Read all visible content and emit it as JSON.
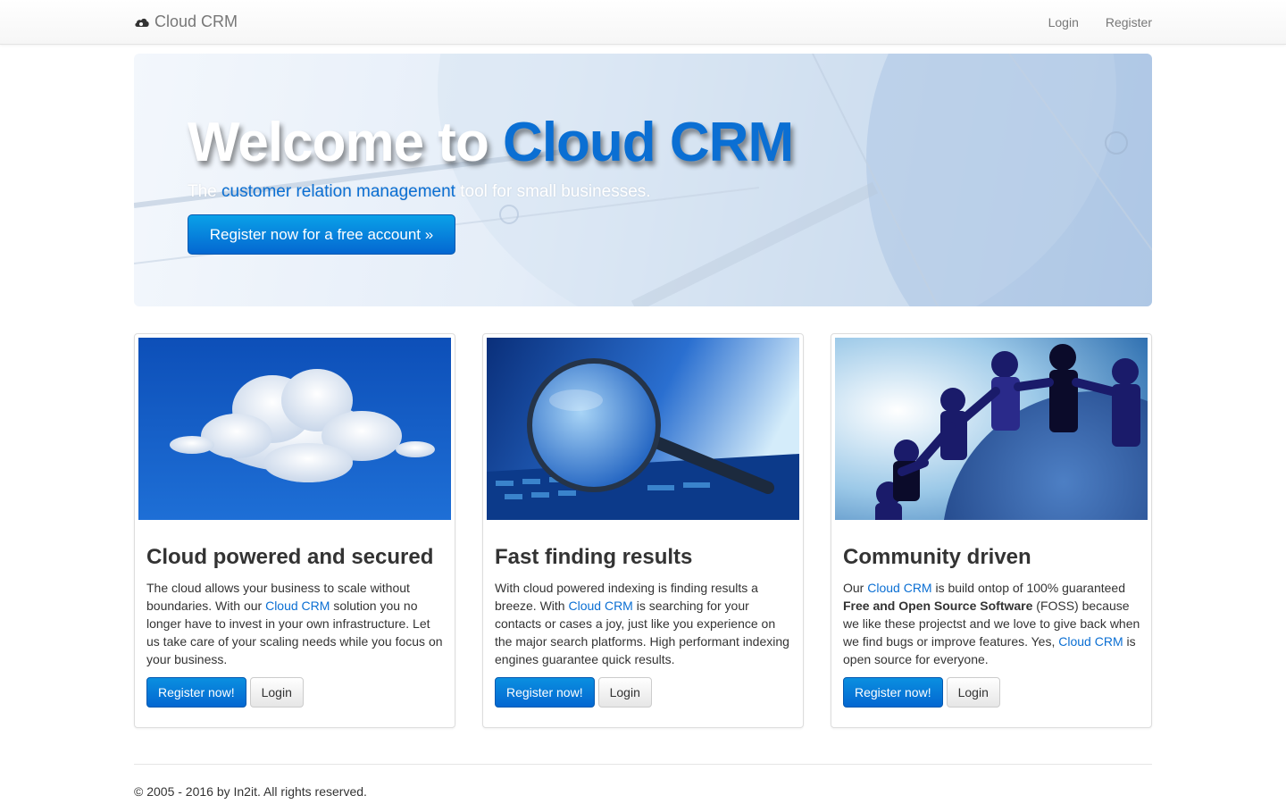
{
  "navbar": {
    "brand_icon": "cloud-icon",
    "brand": "Cloud CRM",
    "links": [
      {
        "label": "Login"
      },
      {
        "label": "Register"
      }
    ]
  },
  "hero": {
    "title_prefix": "Welcome to ",
    "title_accent": "Cloud CRM",
    "lead_prefix": "The ",
    "lead_accent": "customer relation management",
    "lead_suffix": " tool for small businesses.",
    "cta_label": "Register now for a free account »",
    "accent_color": "#0b6fd3"
  },
  "cards": [
    {
      "image": "cloud-sky-image",
      "title": "Cloud powered and secured",
      "text_parts": [
        "The cloud allows your business to scale without boundaries. With our ",
        "Cloud CRM",
        " solution you no longer have to invest in your own infrastructure. Let us take care of your scaling needs while you focus on your business."
      ],
      "register_label": "Register now!",
      "login_label": "Login"
    },
    {
      "image": "magnifying-glass-image",
      "title": "Fast finding results",
      "text_parts": [
        "With cloud powered indexing is finding results a breeze. With ",
        "Cloud CRM",
        " is searching for your contacts or cases a joy, just like you experience on the major search platforms. High performant indexing engines guarantee quick results."
      ],
      "register_label": "Register now!",
      "login_label": "Login"
    },
    {
      "image": "community-globe-image",
      "title": "Community driven",
      "text_parts": [
        "Our ",
        "Cloud CRM",
        " is build ontop of 100% guaranteed ",
        "Free and Open Source Software",
        " (FOSS) because we like these projectst and we love to give back when we find bugs or improve features. Yes, ",
        "Cloud CRM",
        " is open source for everyone."
      ],
      "register_label": "Register now!",
      "login_label": "Login"
    }
  ],
  "footer": {
    "text": "© 2005 - 2016 by In2it. All rights reserved."
  },
  "colors": {
    "primary": "#0467d1",
    "link": "#0b6fd3"
  }
}
